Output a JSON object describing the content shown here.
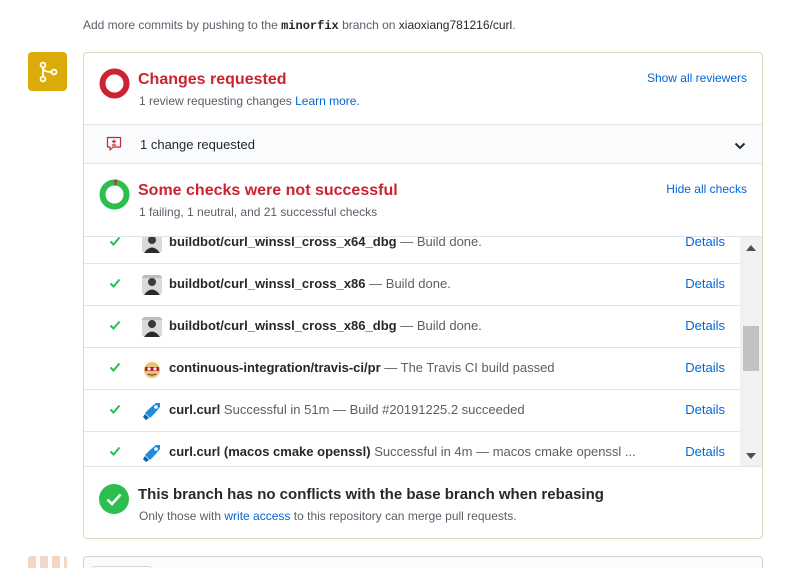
{
  "hint": {
    "prefix": "Add more commits by pushing to the",
    "branch": "minorfix",
    "middle": "branch on",
    "repo": "xiaoxiang781216/curl",
    "suffix": "."
  },
  "reviews": {
    "title": "Changes requested",
    "subtitle": "1 review requesting changes",
    "learn_more": "Learn more.",
    "show_all": "Show all reviewers"
  },
  "change": {
    "text": "1 change requested"
  },
  "checks": {
    "title": "Some checks were not successful",
    "subtitle": "1 failing, 1 neutral, and 21 successful checks",
    "hide_all": "Hide all checks",
    "rows": [
      {
        "context": "buildbot/curl_winssl_cross_x64_dbg",
        "description": "— Build done.",
        "details": "Details",
        "avatar": "buildbot-avatar"
      },
      {
        "context": "buildbot/curl_winssl_cross_x86",
        "description": "— Build done.",
        "details": "Details",
        "avatar": "buildbot-avatar"
      },
      {
        "context": "buildbot/curl_winssl_cross_x86_dbg",
        "description": "— Build done.",
        "details": "Details",
        "avatar": "buildbot-avatar"
      },
      {
        "context": "continuous-integration/travis-ci/pr",
        "description": "— The Travis CI build passed",
        "details": "Details",
        "avatar": "travis-avatar"
      },
      {
        "context": "curl.curl",
        "description": "Successful in 51m — Build #20191225.2 succeeded",
        "details": "Details",
        "avatar": "azure-pipelines-icon"
      },
      {
        "context": "curl.curl (macos cmake openssl)",
        "description": "Successful in 4m — macos cmake openssl ...",
        "details": "Details",
        "avatar": "azure-pipelines-icon"
      }
    ]
  },
  "merge": {
    "title": "This branch has no conflicts with the base branch when rebasing",
    "sub_prefix": "Only those with",
    "sub_link": "write access",
    "sub_suffix": "to this repository can merge pull requests."
  },
  "colors": {
    "danger": "#cb2431",
    "success": "#2cbe4e",
    "link": "#0366d6",
    "merge_icon_bg": "#dbab09"
  }
}
